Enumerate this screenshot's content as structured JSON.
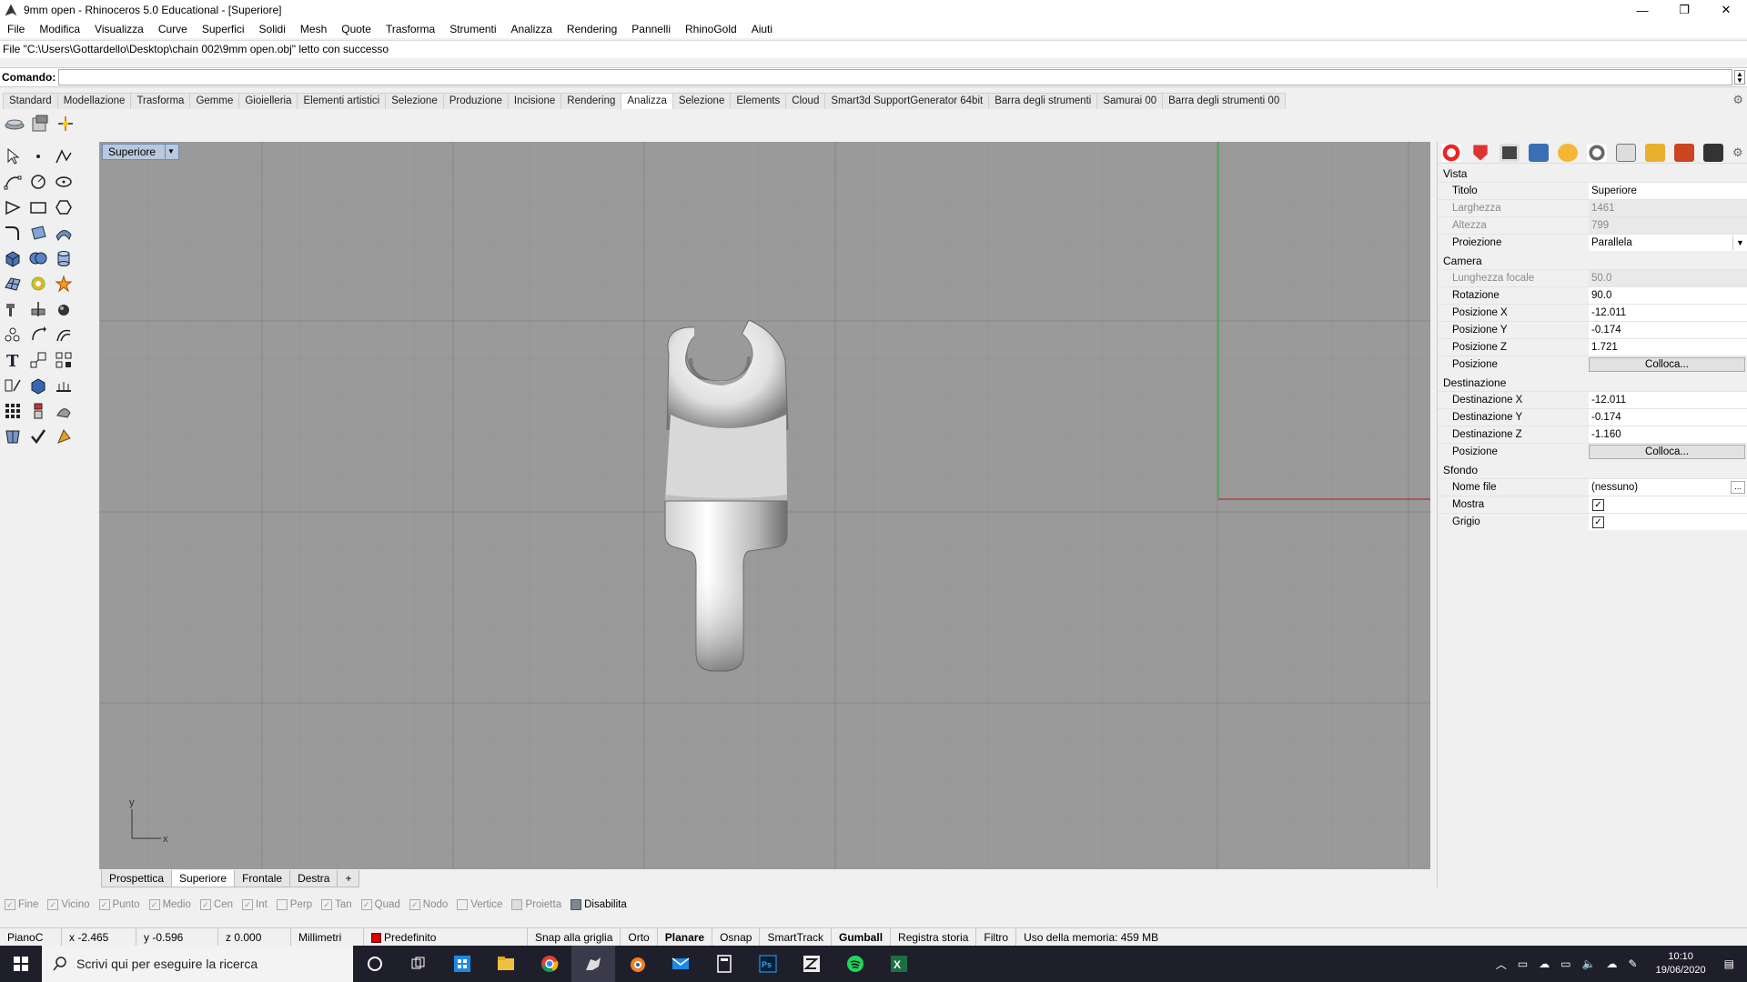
{
  "window": {
    "title": "9mm open - Rhinoceros 5.0 Educational - [Superiore]",
    "buttons": [
      "—",
      "❐",
      "✕"
    ]
  },
  "menubar": [
    "File",
    "Modifica",
    "Visualizza",
    "Curve",
    "Superfici",
    "Solidi",
    "Mesh",
    "Quote",
    "Trasforma",
    "Strumenti",
    "Analizza",
    "Rendering",
    "Pannelli",
    "RhinoGold",
    "Aiuti"
  ],
  "command": {
    "history": "File \"C:\\Users\\Gottardello\\Desktop\\chain 002\\9mm open.obj\" letto con successo",
    "prompt_label": "Comando:",
    "value": ""
  },
  "toolbar_tabs": {
    "items": [
      "Standard",
      "Modellazione",
      "Trasforma",
      "Gemme",
      "Gioielleria",
      "Elementi artistici",
      "Selezione",
      "Produzione",
      "Incisione",
      "Rendering",
      "Analizza",
      "Selezione",
      "Elements",
      "Cloud",
      "Smart3d SupportGenerator 64bit",
      "Barra degli strumenti",
      "Samurai 00",
      "Barra degli strumenti 00"
    ],
    "active_index": 10
  },
  "viewport": {
    "title": "Superiore",
    "axis_x": "x",
    "axis_y": "y"
  },
  "view_tabs": {
    "items": [
      "Prospettica",
      "Superiore",
      "Frontale",
      "Destra"
    ],
    "active_index": 1,
    "add_label": "+"
  },
  "properties": {
    "vista_header": "Vista",
    "titolo_label": "Titolo",
    "titolo_value": "Superiore",
    "larghezza_label": "Larghezza",
    "larghezza_value": "1461",
    "altezza_label": "Altezza",
    "altezza_value": "799",
    "proiezione_label": "Proiezione",
    "proiezione_value": "Parallela",
    "camera_header": "Camera",
    "focale_label": "Lunghezza focale",
    "focale_value": "50.0",
    "rotazione_label": "Rotazione",
    "rotazione_value": "90.0",
    "posx_label": "Posizione X",
    "posx_value": "-12.011",
    "posy_label": "Posizione Y",
    "posy_value": "-0.174",
    "posz_label": "Posizione Z",
    "posz_value": "1.721",
    "pos_label": "Posizione",
    "colloca_label": "Colloca...",
    "dest_header": "Destinazione",
    "destx_label": "Destinazione X",
    "destx_value": "-12.011",
    "desty_label": "Destinazione Y",
    "desty_value": "-0.174",
    "destz_label": "Destinazione Z",
    "destz_value": "-1.160",
    "pos2_label": "Posizione",
    "colloca2_label": "Colloca...",
    "sfondo_header": "Sfondo",
    "nomefile_label": "Nome file",
    "nomefile_value": "(nessuno)",
    "mostra_label": "Mostra",
    "mostra_checked": true,
    "grigio_label": "Grigio",
    "grigio_checked": true
  },
  "osnaps": [
    {
      "label": "Fine",
      "checked": true
    },
    {
      "label": "Vicino",
      "checked": true
    },
    {
      "label": "Punto",
      "checked": true
    },
    {
      "label": "Medio",
      "checked": true
    },
    {
      "label": "Cen",
      "checked": true
    },
    {
      "label": "Int",
      "checked": true
    },
    {
      "label": "Perp",
      "checked": false
    },
    {
      "label": "Tan",
      "checked": true
    },
    {
      "label": "Quad",
      "checked": true
    },
    {
      "label": "Nodo",
      "checked": true
    },
    {
      "label": "Vertice",
      "checked": false
    },
    {
      "label": "Proietta",
      "checked": false
    },
    {
      "label": "Disabilita",
      "checked": false,
      "enabled": true
    }
  ],
  "statusbar": {
    "cplane": "PianoC",
    "x": "x -2.465",
    "y": "y -0.596",
    "z": "z 0.000",
    "units": "Millimetri",
    "layer": "Predefinito",
    "layer_color": "#d80000",
    "snap": "Snap alla griglia",
    "ortho": "Orto",
    "planar": "Planare",
    "osnap": "Osnap",
    "smarttrack": "SmartTrack",
    "gumball": "Gumball",
    "history": "Registra storia",
    "filter": "Filtro",
    "memory": "Uso della memoria: 459 MB"
  },
  "taskbar": {
    "search_placeholder": "Scrivi qui per eseguire la ricerca",
    "time": "10:10",
    "date": "19/06/2020"
  },
  "colors": {
    "viewport_bg": "#9a9a9a",
    "grid_major": "#8a8a8a",
    "axis_x": "#b03030",
    "axis_y": "#30a030",
    "taskbar_bg": "#1f1f2b"
  }
}
